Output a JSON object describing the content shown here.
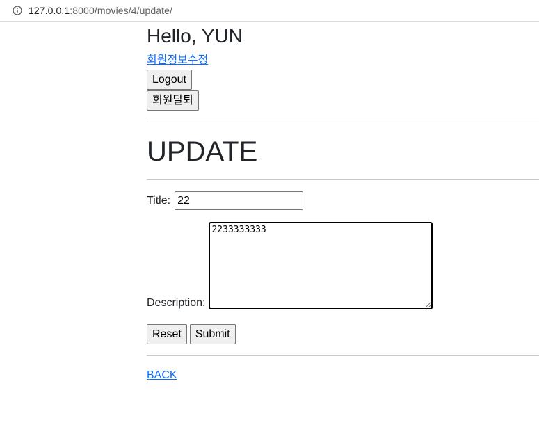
{
  "browser": {
    "url_host": "127.0.0.1",
    "url_rest": ":8000/movies/4/update/",
    "info_icon": "info-circle-icon"
  },
  "header": {
    "greeting": "Hello, YUN",
    "profile_edit_link": "회원정보수정",
    "logout_label": "Logout",
    "withdraw_label": "회원탈퇴"
  },
  "page": {
    "heading": "UPDATE"
  },
  "form": {
    "title_label": "Title:",
    "title_value": "22",
    "description_label": "Description:",
    "description_value": "2233333333",
    "reset_label": "Reset",
    "submit_label": "Submit"
  },
  "footer": {
    "back_label": "BACK"
  },
  "colors": {
    "link": "#0d6efd",
    "text": "#212529"
  }
}
